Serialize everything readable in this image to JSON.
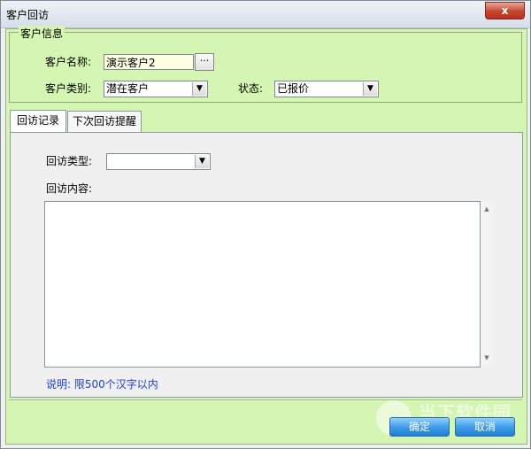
{
  "window": {
    "title": "客户回访",
    "close_glyph": "x"
  },
  "customer_info": {
    "legend": "客户信息",
    "name_label": "客户名称:",
    "name_value": "演示客户2",
    "name_button": "···",
    "category_label": "客户类别:",
    "category_value": "潜在客户",
    "status_label": "状态:",
    "status_value": "已报价"
  },
  "tabs": [
    {
      "label": "回访记录",
      "active": true
    },
    {
      "label": "下次回访提醒",
      "active": false
    }
  ],
  "visit": {
    "type_label": "回访类型:",
    "type_value": "",
    "content_label": "回访内容:",
    "content_value": "",
    "note": "说明: 限500个汉字以内"
  },
  "footer": {
    "ok_label": "确定",
    "cancel_label": "取消"
  },
  "watermark": {
    "text": "当下软件园"
  },
  "colors": {
    "panel_green": "#d5f5b2",
    "note_blue": "#1a3fd6",
    "button_blue": "#3d9ae8",
    "close_red": "#c7452e"
  }
}
